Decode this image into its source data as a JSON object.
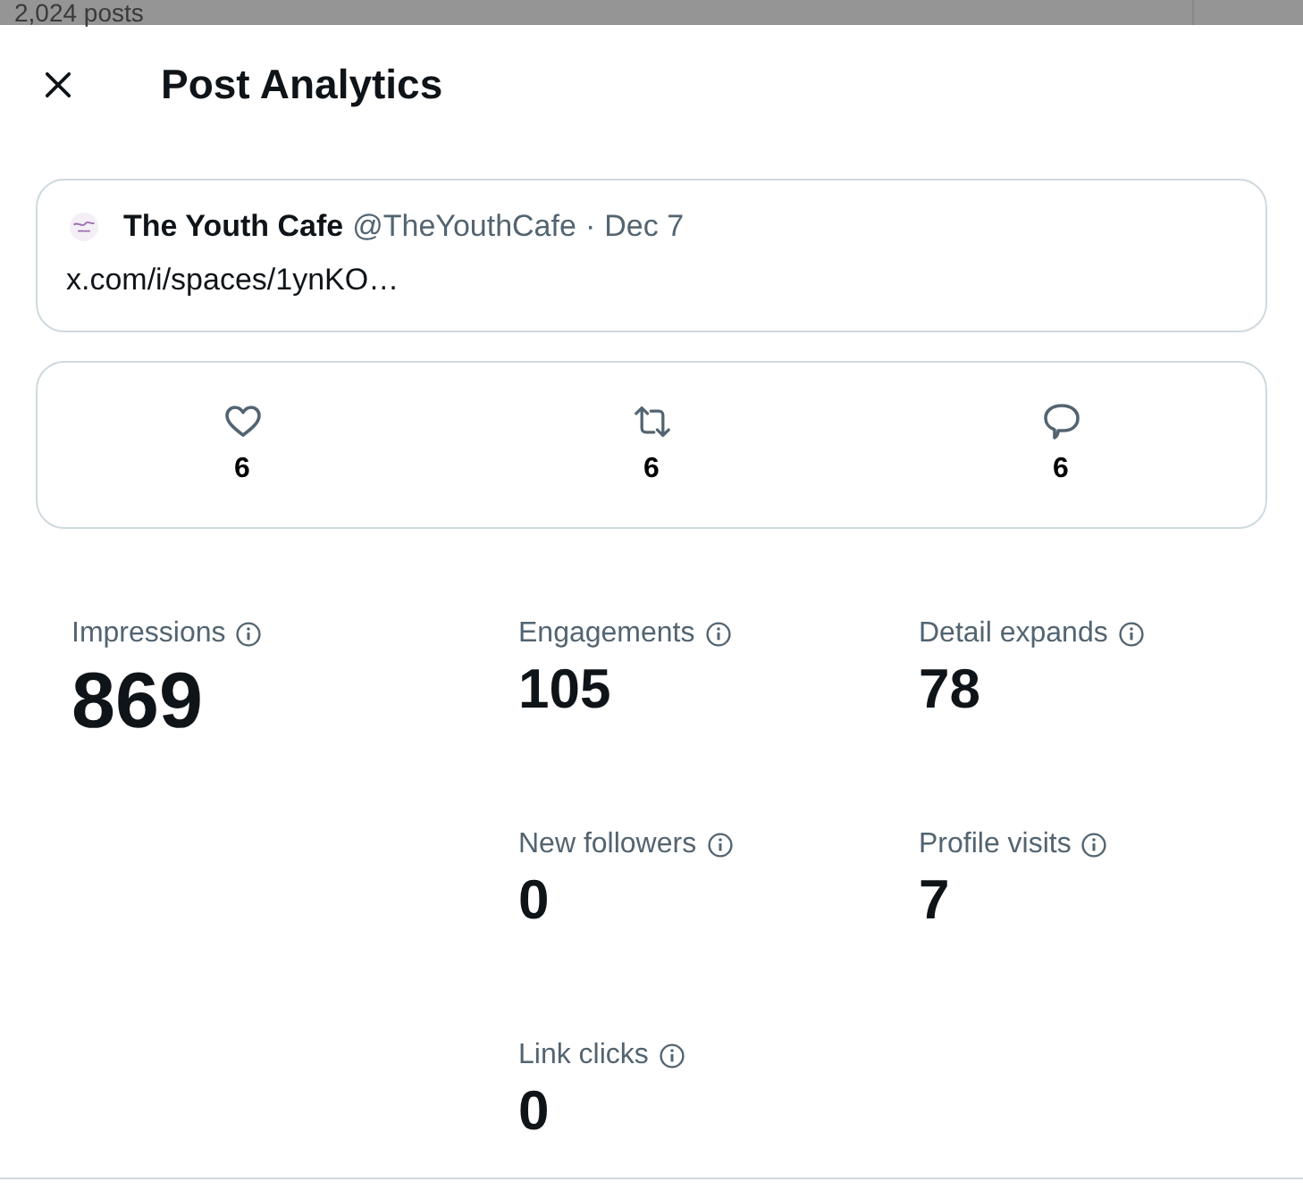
{
  "background": {
    "post_count": "2,024 posts"
  },
  "modal": {
    "title": "Post Analytics"
  },
  "post": {
    "author": "The Youth Cafe",
    "handle": "@TheYouthCafe",
    "separator": "·",
    "date": "Dec 7",
    "text": "x.com/i/spaces/1ynKO…"
  },
  "engagement": [
    {
      "kind": "likes",
      "count": "6"
    },
    {
      "kind": "reposts",
      "count": "6"
    },
    {
      "kind": "replies",
      "count": "6"
    }
  ],
  "metrics": [
    {
      "kind": "primary",
      "label": "Impressions",
      "value": "869"
    },
    {
      "kind": "secondary",
      "label": "Engagements",
      "value": "105"
    },
    {
      "kind": "secondary",
      "label": "Detail expands",
      "value": "78"
    },
    {
      "kind": "secondary",
      "label": "New followers",
      "value": "0"
    },
    {
      "kind": "secondary",
      "label": "Profile visits",
      "value": "7"
    },
    {
      "kind": "secondary",
      "label": "Link clicks",
      "value": "0"
    }
  ]
}
